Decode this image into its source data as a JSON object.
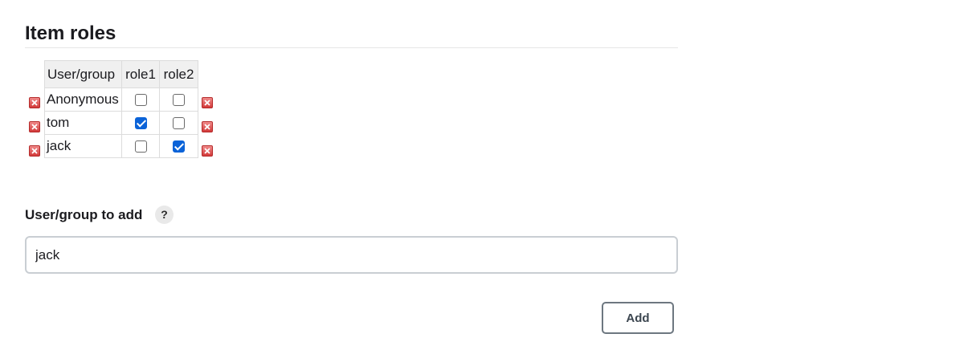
{
  "section": {
    "title": "Item roles"
  },
  "roles_table": {
    "headers": [
      "User/group",
      "role1",
      "role2"
    ],
    "rows": [
      {
        "name": "Anonymous",
        "role1": false,
        "role2": false
      },
      {
        "name": "tom",
        "role1": true,
        "role2": false
      },
      {
        "name": "jack",
        "role1": false,
        "role2": true
      }
    ],
    "delete_icon": "delete-icon"
  },
  "add_form": {
    "label": "User/group to add",
    "help_glyph": "?",
    "input_value": "jack",
    "button_label": "Add"
  },
  "colors": {
    "checked": "#0b63d8",
    "delete": "#d23a3a"
  }
}
